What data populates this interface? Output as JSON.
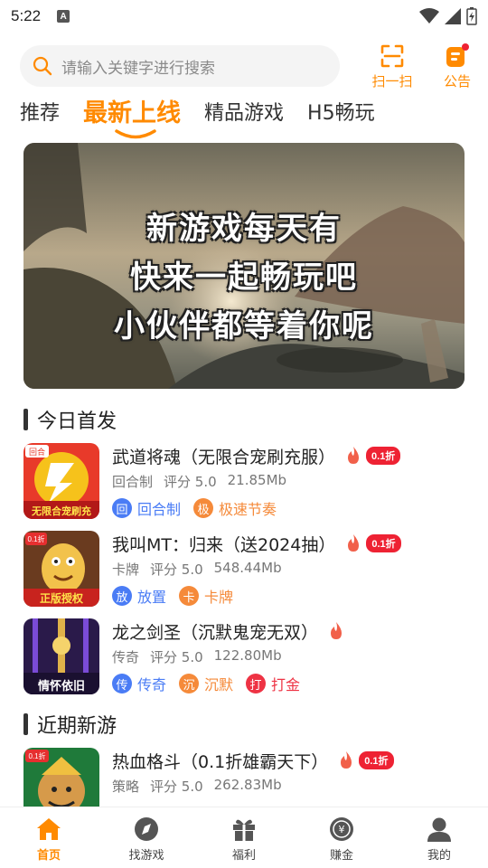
{
  "status_bar": {
    "time": "5:22",
    "notification_letter": "A"
  },
  "search": {
    "placeholder": "请输入关键字进行搜索"
  },
  "top_actions": {
    "scan_label": "扫一扫",
    "notice_label": "公告"
  },
  "tabs": [
    {
      "label": "推荐",
      "active": false
    },
    {
      "label": "最新上线",
      "active": true
    },
    {
      "label": "精品游戏",
      "active": false
    },
    {
      "label": "H5畅玩",
      "active": false
    }
  ],
  "banner": {
    "lines": [
      "新游戏每天有",
      "快来一起畅玩吧",
      "小伙伴都等着你呢"
    ]
  },
  "sections": {
    "today": "今日首发",
    "recent": "近期新游"
  },
  "games": [
    {
      "title": "武道将魂（无限合宠刷充服）",
      "discount": "0.1折",
      "category": "回合制",
      "rating": "评分 5.0",
      "size": "21.85Mb",
      "icon_text": "无限合宠刷充",
      "icon_badge": "回合",
      "tags": [
        {
          "mark": "回",
          "text": "回合制",
          "color": "#4a7cf5"
        },
        {
          "mark": "极",
          "text": "极速节奏",
          "color": "#f58a3a"
        }
      ]
    },
    {
      "title": "我叫MT：归来（送2024抽）",
      "discount": "0.1折",
      "category": "卡牌",
      "rating": "评分 5.0",
      "size": "548.44Mb",
      "icon_text": "正版授权",
      "icon_badge": "0.1折",
      "tags": [
        {
          "mark": "放",
          "text": "放置",
          "color": "#4a7cf5"
        },
        {
          "mark": "卡",
          "text": "卡牌",
          "color": "#f58a3a"
        }
      ]
    },
    {
      "title": "龙之剑圣（沉默鬼宠无双）",
      "discount": "",
      "category": "传奇",
      "rating": "评分 5.0",
      "size": "122.80Mb",
      "icon_text": "情怀依旧",
      "icon_badge": "",
      "tags": [
        {
          "mark": "传",
          "text": "传奇",
          "color": "#4a7cf5"
        },
        {
          "mark": "沉",
          "text": "沉默",
          "color": "#f58a3a"
        },
        {
          "mark": "打",
          "text": "打金",
          "color": "#ee3344"
        }
      ]
    },
    {
      "title": "热血格斗（0.1折雄霸天下）",
      "discount": "0.1折",
      "category": "策略",
      "rating": "评分 5.0",
      "size": "262.83Mb",
      "icon_text": "",
      "icon_badge": "0.1折",
      "tags": []
    }
  ],
  "bottom_nav": [
    {
      "label": "首页",
      "icon": "home-icon",
      "active": true
    },
    {
      "label": "找游戏",
      "icon": "compass-icon",
      "active": false
    },
    {
      "label": "福利",
      "icon": "gift-icon",
      "active": false
    },
    {
      "label": "赚金",
      "icon": "coin-icon",
      "active": false
    },
    {
      "label": "我的",
      "icon": "user-icon",
      "active": false
    }
  ],
  "colors": {
    "accent": "#ff8a00",
    "discount": "#ee2233"
  }
}
